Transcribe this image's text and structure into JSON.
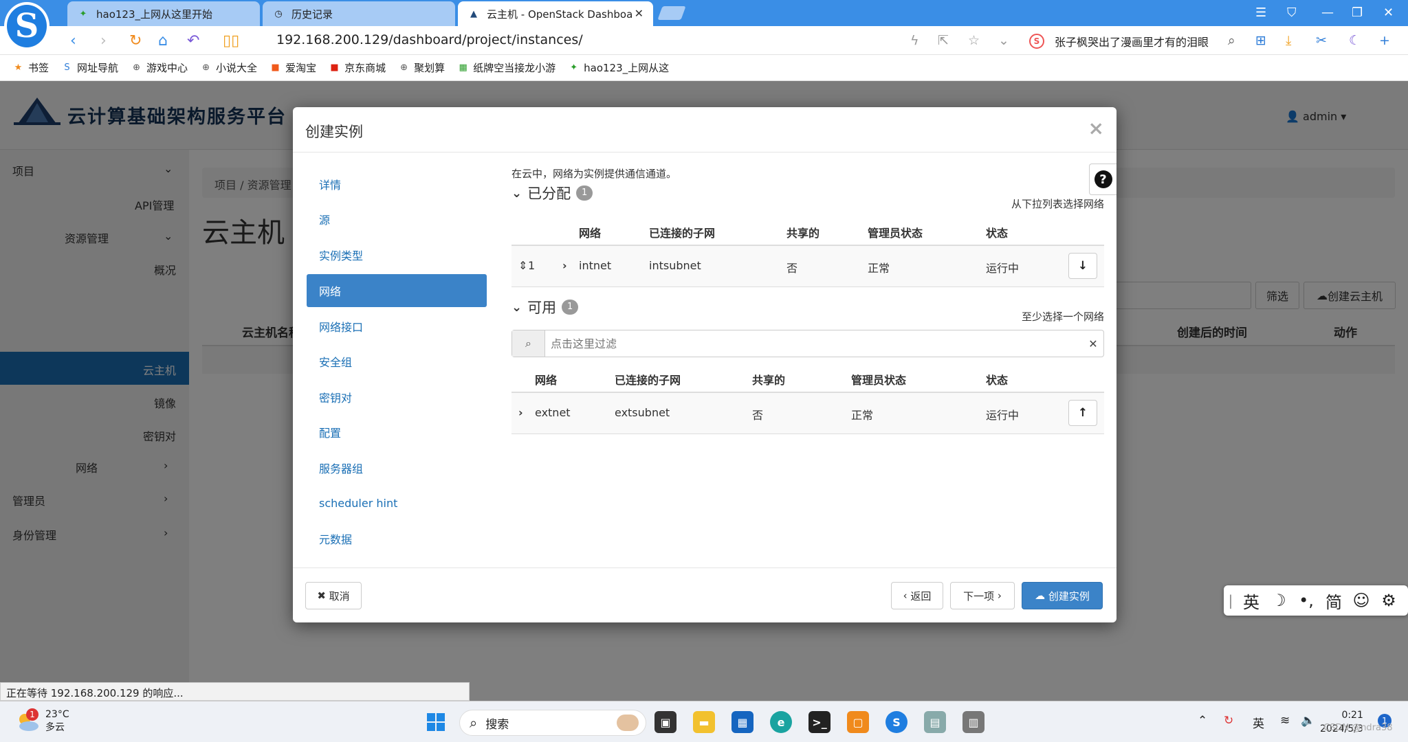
{
  "browser": {
    "tabs": [
      {
        "label": "hao123_上网从这里开始",
        "icon": "hao123-icon"
      },
      {
        "label": "历史记录",
        "icon": "history-icon"
      },
      {
        "label": "云主机 - OpenStack Dashboa",
        "icon": "openstack-icon"
      }
    ],
    "url": "192.168.200.129/dashboard/project/instances/",
    "news_text": "张子枫哭出了漫画里才有的泪眼",
    "bookmarks": [
      "书签",
      "网址导航",
      "游戏中心",
      "小说大全",
      "爱淘宝",
      "京东商城",
      "聚划算",
      "纸牌空当接龙小游",
      "hao123_上网从这"
    ],
    "status_text": "正在等待 192.168.200.129 的响应..."
  },
  "app": {
    "brand": "云计算基础架构服务平台",
    "user": "admin",
    "sidebar": {
      "project": "项目",
      "api": "API管理",
      "resource": "资源管理",
      "overview": "概况",
      "instances": "云主机",
      "images": "镜像",
      "keypairs": "密钥对",
      "network": "网络",
      "admin": "管理员",
      "identity": "身份管理"
    },
    "breadcrumb": "项目 /  资源管理",
    "page_title": "云主机",
    "filter_button": "筛选",
    "create_button": "创建云主机",
    "columns": [
      "云主机名称",
      "创建后的时间",
      "动作"
    ]
  },
  "modal": {
    "title": "创建实例",
    "close": "×",
    "steps": [
      "详情",
      "源",
      "实例类型",
      "网络",
      "网络接口",
      "安全组",
      "密钥对",
      "配置",
      "服务器组",
      "scheduler hint",
      "元数据"
    ],
    "active_step": "网络",
    "intro": "在云中，网络为实例提供通信通道。",
    "allocated": {
      "title": "已分配",
      "count": "1",
      "hint": "从下拉列表选择网络",
      "columns": [
        "网络",
        "已连接的子网",
        "共享的",
        "管理员状态",
        "状态"
      ],
      "rows": [
        {
          "order": "1",
          "network": "intnet",
          "subnet": "intsubnet",
          "shared": "否",
          "admin_state": "正常",
          "status": "运行中"
        }
      ]
    },
    "available": {
      "title": "可用",
      "count": "1",
      "hint": "至少选择一个网络",
      "filter_placeholder": "点击这里过滤",
      "columns": [
        "网络",
        "已连接的子网",
        "共享的",
        "管理员状态",
        "状态"
      ],
      "rows": [
        {
          "network": "extnet",
          "subnet": "extsubnet",
          "shared": "否",
          "admin_state": "正常",
          "status": "运行中"
        }
      ]
    },
    "footer": {
      "cancel": "取消",
      "back": "返回",
      "next": "下一项",
      "create": "创建实例"
    }
  },
  "ime": [
    "英",
    "简"
  ],
  "taskbar": {
    "weather_temp": "23°C",
    "weather_desc": "多云",
    "weather_alert": "1",
    "search": "搜索",
    "tray_lang": "英",
    "time": "0:21",
    "date": "2024/5/3",
    "notification_count": "1",
    "watermark": "CSDN @ndra38"
  },
  "colors": {
    "accent": "#3b83c8",
    "tabbar": "#3a8ee6",
    "sidebar_active": "#1a6fb5"
  }
}
